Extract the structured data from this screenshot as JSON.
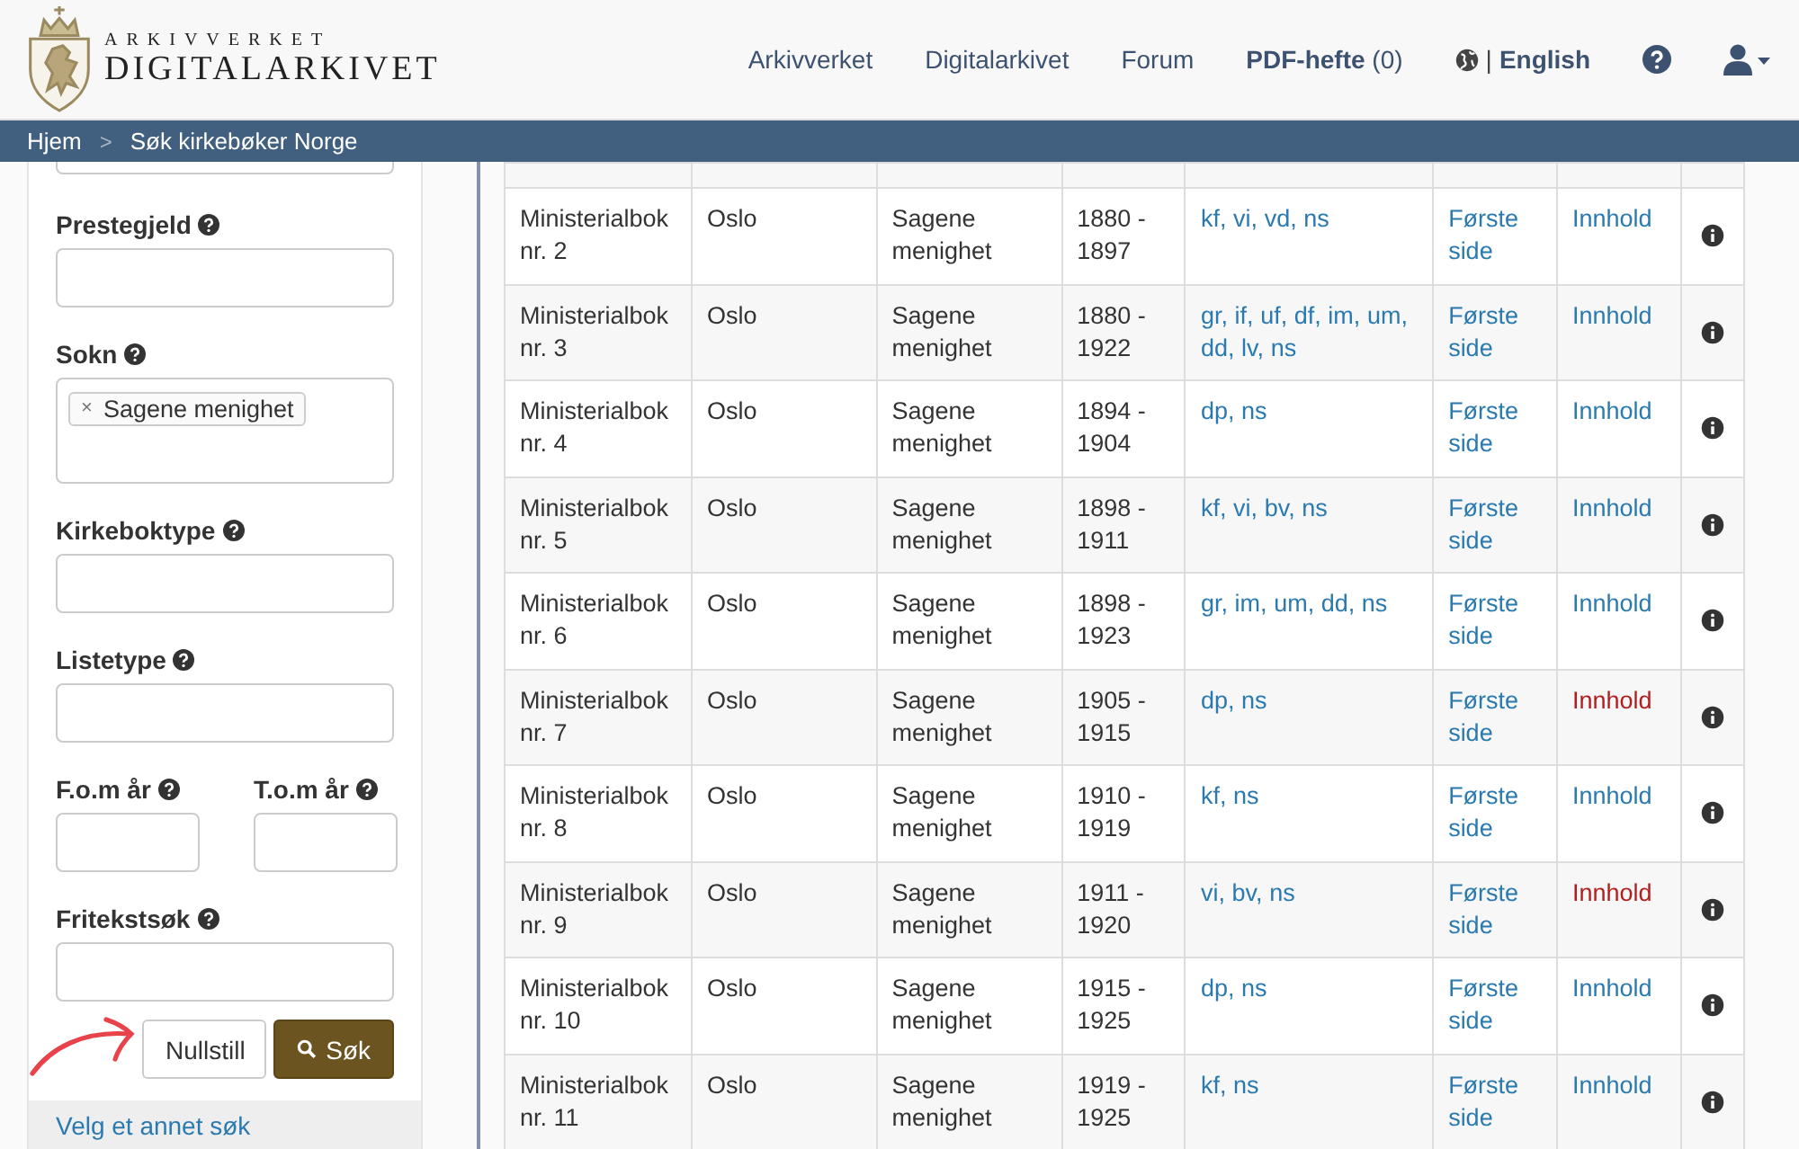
{
  "header": {
    "logo_top": "ARKIVVERKET",
    "logo_bottom": "DIGITALARKIVET",
    "nav": [
      {
        "label": "Arkivverket"
      },
      {
        "label": "Digitalarkivet"
      },
      {
        "label": "Forum"
      }
    ],
    "pdf": {
      "label": "PDF-hefte",
      "count": "(0)"
    },
    "language_separator": "|",
    "language": "English"
  },
  "breadcrumb": {
    "items": [
      {
        "label": "Hjem"
      },
      {
        "label": "Søk kirkebøker Norge"
      }
    ],
    "separator": ">"
  },
  "sidebar": {
    "fields": [
      {
        "kind": "text",
        "label": "Prestegjeld"
      },
      {
        "kind": "tags",
        "label": "Sokn",
        "remove_mark": "×",
        "tags": [
          "Sagene menighet"
        ]
      },
      {
        "kind": "text",
        "label": "Kirkeboktype"
      },
      {
        "kind": "text",
        "label": "Listetype"
      },
      {
        "kind": "pair",
        "fields": [
          {
            "label": "F.o.m år"
          },
          {
            "label": "T.o.m år"
          }
        ]
      },
      {
        "kind": "text",
        "label": "Fritekstsøk"
      }
    ],
    "reset_button": "Nullstill",
    "search_button": "Søk",
    "other_search_link": "Velg et annet søk"
  },
  "table": {
    "code_separator": ",",
    "rows": [
      {
        "book": "Ministerialbok nr. 2",
        "place": "Oslo",
        "parish": "Sagene menighet",
        "years": "1880 - 1897",
        "codes": [
          "kf",
          "vi",
          "vd",
          "ns"
        ],
        "first_page": "Første side",
        "contents": "Innhold",
        "flagged": false
      },
      {
        "book": "Ministerialbok nr. 3",
        "place": "Oslo",
        "parish": "Sagene menighet",
        "years": "1880 - 1922",
        "codes": [
          "gr",
          "if",
          "uf",
          "df",
          "im",
          "um",
          "dd",
          "lv",
          "ns"
        ],
        "first_page": "Første side",
        "contents": "Innhold",
        "flagged": false
      },
      {
        "book": "Ministerialbok nr. 4",
        "place": "Oslo",
        "parish": "Sagene menighet",
        "years": "1894 - 1904",
        "codes": [
          "dp",
          "ns"
        ],
        "first_page": "Første side",
        "contents": "Innhold",
        "flagged": false
      },
      {
        "book": "Ministerialbok nr. 5",
        "place": "Oslo",
        "parish": "Sagene menighet",
        "years": "1898 - 1911",
        "codes": [
          "kf",
          "vi",
          "bv",
          "ns"
        ],
        "first_page": "Første side",
        "contents": "Innhold",
        "flagged": false
      },
      {
        "book": "Ministerialbok nr. 6",
        "place": "Oslo",
        "parish": "Sagene menighet",
        "years": "1898 - 1923",
        "codes": [
          "gr",
          "im",
          "um",
          "dd",
          "ns"
        ],
        "first_page": "Første side",
        "contents": "Innhold",
        "flagged": false
      },
      {
        "book": "Ministerialbok nr. 7",
        "place": "Oslo",
        "parish": "Sagene menighet",
        "years": "1905 - 1915",
        "codes": [
          "dp",
          "ns"
        ],
        "first_page": "Første side",
        "contents": "Innhold",
        "flagged": true
      },
      {
        "book": "Ministerialbok nr. 8",
        "place": "Oslo",
        "parish": "Sagene menighet",
        "years": "1910 - 1919",
        "codes": [
          "kf",
          "ns"
        ],
        "first_page": "Første side",
        "contents": "Innhold",
        "flagged": false
      },
      {
        "book": "Ministerialbok nr. 9",
        "place": "Oslo",
        "parish": "Sagene menighet",
        "years": "1911 - 1920",
        "codes": [
          "vi",
          "bv",
          "ns"
        ],
        "first_page": "Første side",
        "contents": "Innhold",
        "flagged": true
      },
      {
        "book": "Ministerialbok nr. 10",
        "place": "Oslo",
        "parish": "Sagene menighet",
        "years": "1915 - 1925",
        "codes": [
          "dp",
          "ns"
        ],
        "first_page": "Første side",
        "contents": "Innhold",
        "flagged": false
      },
      {
        "book": "Ministerialbok nr. 11",
        "place": "Oslo",
        "parish": "Sagene menighet",
        "years": "1919 - 1925",
        "codes": [
          "kf",
          "ns"
        ],
        "first_page": "Første side",
        "contents": "Innhold",
        "flagged": false
      }
    ]
  }
}
